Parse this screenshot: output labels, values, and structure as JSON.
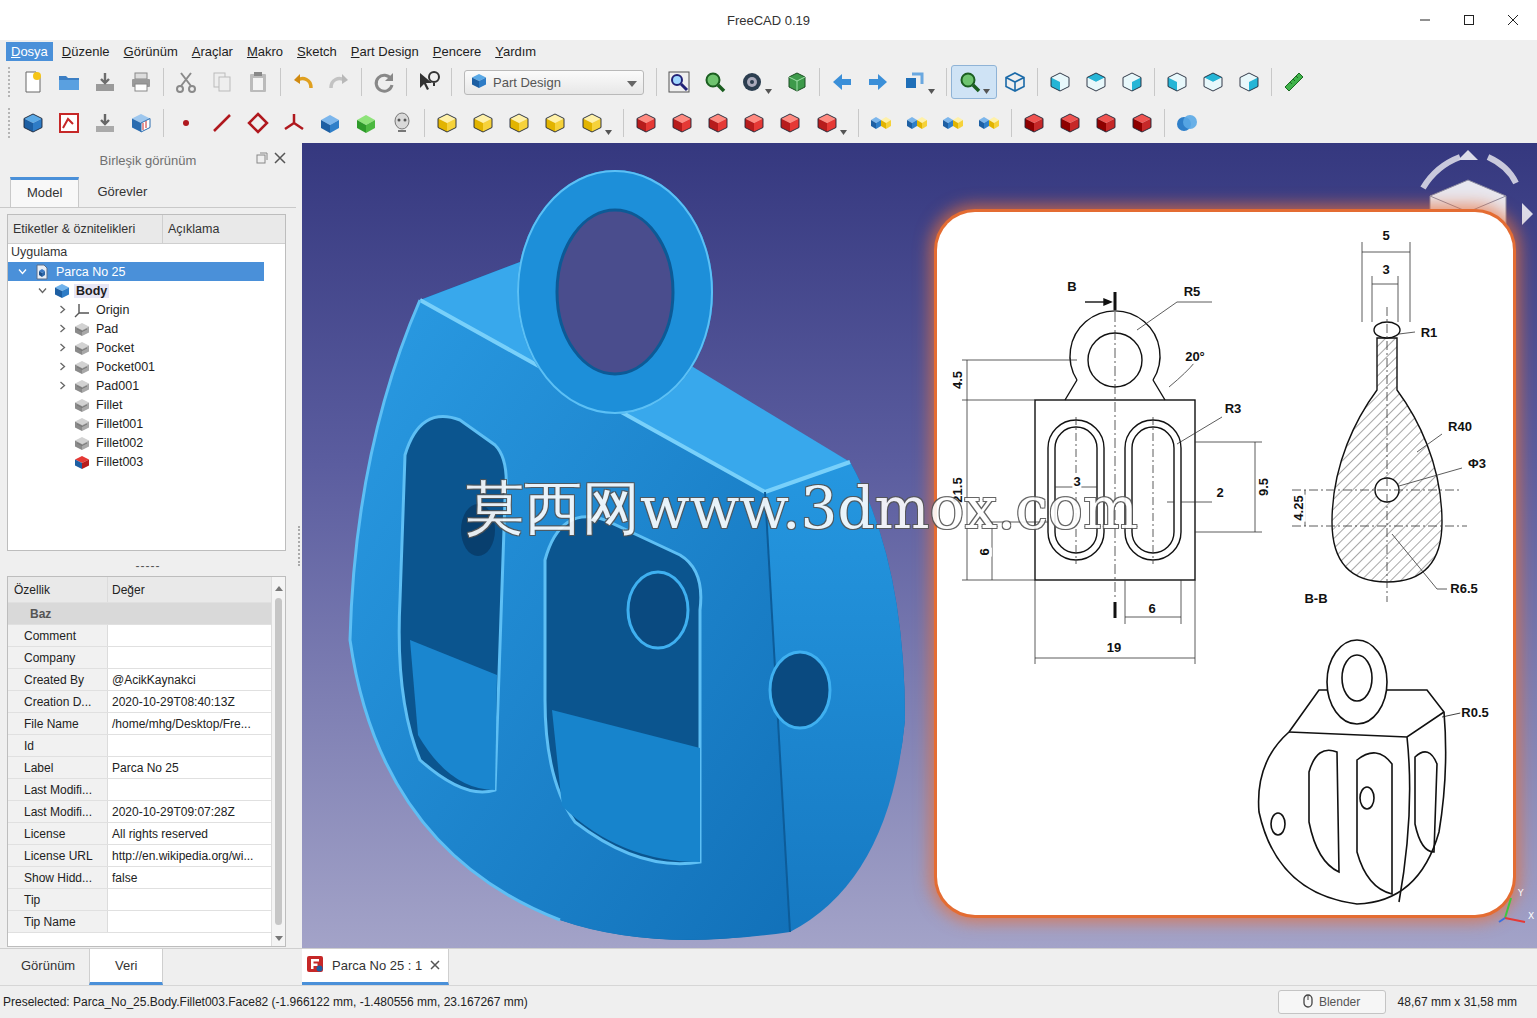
{
  "window": {
    "title": "FreeCAD 0.19"
  },
  "menu": [
    {
      "label": "Dosya",
      "selected": true
    },
    {
      "label": "Düzenle",
      "selected": false
    },
    {
      "label": "Görünüm",
      "selected": false
    },
    {
      "label": "Araçlar",
      "selected": false
    },
    {
      "label": "Makro",
      "selected": false
    },
    {
      "label": "Sketch",
      "selected": false
    },
    {
      "label": "Part Design",
      "selected": false
    },
    {
      "label": "Pencere",
      "selected": false
    },
    {
      "label": "Yardım",
      "selected": false
    }
  ],
  "toolbar": {
    "workbench": "Part Design"
  },
  "combo_view": {
    "title": "Birleşik görünüm",
    "tabs": [
      {
        "label": "Model",
        "selected": true
      },
      {
        "label": "Görevler",
        "selected": false
      }
    ],
    "tree": {
      "columns": [
        "Etiketler & öznitelikleri",
        "Açıklama"
      ],
      "root_label": "Uygulama",
      "items": [
        {
          "label": "Parca No 25",
          "level": 0,
          "kind": "document",
          "expandable": true,
          "expanded": true,
          "selected": true,
          "active": false
        },
        {
          "label": "Body",
          "level": 1,
          "kind": "body",
          "expandable": true,
          "expanded": true,
          "selected": false,
          "active": true
        },
        {
          "label": "Origin",
          "level": 2,
          "kind": "origin",
          "expandable": true,
          "expanded": false,
          "selected": false,
          "active": false
        },
        {
          "label": "Pad",
          "level": 2,
          "kind": "feature",
          "expandable": true,
          "expanded": false,
          "selected": false,
          "active": false
        },
        {
          "label": "Pocket",
          "level": 2,
          "kind": "feature",
          "expandable": true,
          "expanded": false,
          "selected": false,
          "active": false
        },
        {
          "label": "Pocket001",
          "level": 2,
          "kind": "feature",
          "expandable": true,
          "expanded": false,
          "selected": false,
          "active": false
        },
        {
          "label": "Pad001",
          "level": 2,
          "kind": "feature",
          "expandable": true,
          "expanded": false,
          "selected": false,
          "active": false
        },
        {
          "label": "Fillet",
          "level": 2,
          "kind": "feature",
          "expandable": false,
          "expanded": false,
          "selected": false,
          "active": false
        },
        {
          "label": "Fillet001",
          "level": 2,
          "kind": "feature",
          "expandable": false,
          "expanded": false,
          "selected": false,
          "active": false
        },
        {
          "label": "Fillet002",
          "level": 2,
          "kind": "feature",
          "expandable": false,
          "expanded": false,
          "selected": false,
          "active": false
        },
        {
          "label": "Fillet003",
          "level": 2,
          "kind": "tip",
          "expandable": false,
          "expanded": false,
          "selected": false,
          "active": false
        }
      ]
    },
    "splitter": "-----",
    "properties": {
      "columns": [
        "Özellik",
        "Değer"
      ],
      "group": "Baz",
      "rows": [
        {
          "name": "Comment",
          "value": ""
        },
        {
          "name": "Company",
          "value": ""
        },
        {
          "name": "Created By",
          "value": "@AcikKaynakci"
        },
        {
          "name": "Creation D...",
          "value": "2020-10-29T08:40:13Z"
        },
        {
          "name": "File Name",
          "value": "/home/mhg/Desktop/Fre..."
        },
        {
          "name": "Id",
          "value": ""
        },
        {
          "name": "Label",
          "value": "Parca No 25"
        },
        {
          "name": "Last Modifi...",
          "value": ""
        },
        {
          "name": "Last Modifi...",
          "value": "2020-10-29T09:07:28Z"
        },
        {
          "name": "License",
          "value": "All rights reserved"
        },
        {
          "name": "License URL",
          "value": "http://en.wikipedia.org/wi..."
        },
        {
          "name": "Show Hidd...",
          "value": "false"
        },
        {
          "name": "Tip",
          "value": ""
        },
        {
          "name": "Tip Name",
          "value": ""
        }
      ]
    },
    "bottom_tabs": [
      {
        "label": "Görünüm",
        "selected": false
      },
      {
        "label": "Veri",
        "selected": true
      }
    ]
  },
  "view": {
    "drawing_labels": [
      "B",
      "R5",
      "20°",
      "4.5",
      "R3",
      "21.5",
      "3",
      "2",
      "9.5",
      "6",
      "6",
      "19",
      "5",
      "3",
      "R1",
      "R40",
      "Φ3",
      "4.25",
      "R6.5",
      "B-B",
      "R0.5"
    ],
    "watermark": "莫西网www.3dmox.com",
    "axis_labels": [
      "Y",
      "X"
    ]
  },
  "doc_tabs": [
    {
      "label": "Parca No 25 : 1",
      "selected": true
    }
  ],
  "status_bar": {
    "message": "Preselected: Parca_No_25.Body.Fillet003.Face82 (-1.966122 mm, -1.480556 mm, 23.167267 mm)",
    "nav_style": "Blender",
    "dimensions": "48,67 mm x 31,58 mm"
  }
}
